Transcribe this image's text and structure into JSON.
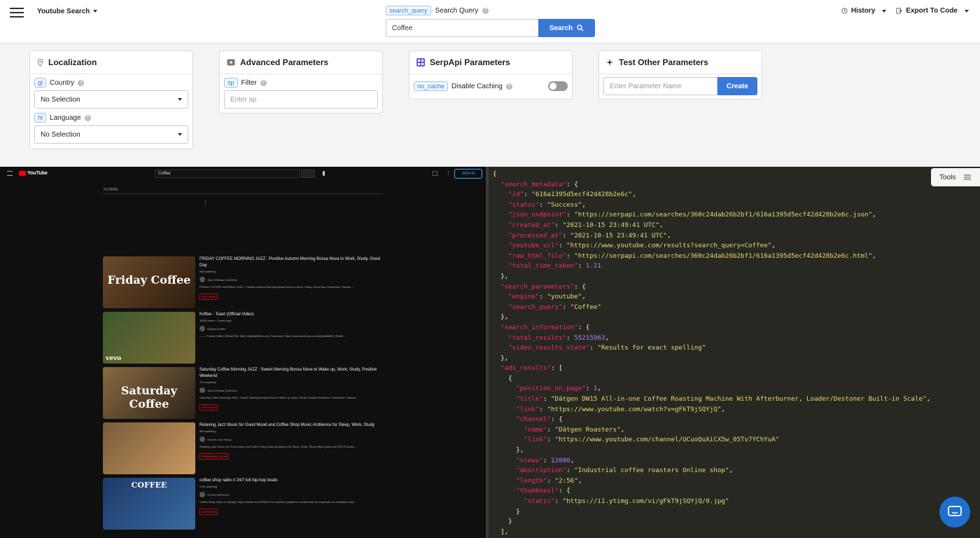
{
  "topbar": {
    "engine_label": "Youtube Search",
    "query_tag": "search_query",
    "query_label": "Search Query",
    "query_value": "Coffee",
    "search_button": "Search",
    "history_label": "History",
    "export_label": "Export To Code"
  },
  "cards": {
    "localization": {
      "title": "Localization",
      "country_tag": "gl",
      "country_label": "Country",
      "country_value": "No Selection",
      "language_tag": "hl",
      "language_label": "Language",
      "language_value": "No Selection"
    },
    "advanced": {
      "title": "Advanced Parameters",
      "filter_tag": "sp",
      "filter_label": "Filter",
      "filter_placeholder": "Enter sp"
    },
    "serpapi": {
      "title": "SerpApi Parameters",
      "cache_tag": "no_cache",
      "cache_label": "Disable Caching"
    },
    "test": {
      "title": "Test Other Parameters",
      "param_placeholder": "Enter Parameter Name",
      "create_button": "Create"
    }
  },
  "youtube": {
    "logo": "YouTube",
    "search_value": "Coffee",
    "signin": "SIGN IN",
    "filters": "FILTERS",
    "videos": [
      {
        "title": "FRIDAY COFFEE MORNING JAZZ : Positive Autumn Morning Bossa Nova to Work, Study, Good Day",
        "meta": "588 watching",
        "channel": "Jazz & Bossa Collection",
        "desc": "FRIDAY COFFEE MORNING JAZZ : Positive Autumn Morning Bossa Nova to Work, Study, Good Day. Download / Stream ...",
        "badge": "LIVE NOW",
        "thumb_text": "Friday Coffee"
      },
      {
        "title": "Koffee - Toast (Official Video)",
        "meta": "184M views • 3 years ago",
        "channel": "Original Koffee",
        "desc": "------- Follow Koffee Official Site: http://originalkoffee.com Facebook: https://www.facebook.com/originalkoffee Twitter: ...",
        "badge": "",
        "thumb_text": "vevo"
      },
      {
        "title": "Saturday Coffee Morning JAZZ : Sweet Morning Bossa Nova to Wake up, Work, Study, Positive Weekend",
        "meta": "974 watching",
        "channel": "Jazz & Bossa Collection",
        "desc": "Saturday Coffee Morning JAZZ : Sweet Morning Bossa Nova to Wake up, Work, Study, Positive Weekend. Download / Stream ...",
        "badge": "LIVE NOW",
        "thumb_text": "Saturday Coffee"
      },
      {
        "title": "Relaxing Jazz Music for Good Mood and Coffee Shop Music Ambience for Sleep, Work, Study",
        "meta": "869 watching",
        "channel": "Smooth Jazz Music",
        "desc": "Relaxing Jazz Music for Good Mood and Coffee Shop Music Ambience for Sleep, Work, Study https://youtu.be/7JRr7KomJIA ...",
        "badge": "PREMIERING NOW",
        "thumb_text": ""
      },
      {
        "title": "coffee shop radio // 24/7 lofi hip-hop beats",
        "meta": "1.3K watching",
        "channel": "STEEZYASFUCK",
        "desc": "Coffee Shop Vibes on Spotify: https://fanlink.to/CSVibes This stream's playlist is curated with an emphasis on meditation and ...",
        "badge": "LIVE NOW",
        "thumb_text": "COFFEE"
      }
    ]
  },
  "tools_label": "Tools",
  "json_lines": [
    [
      [
        "p",
        "{"
      ]
    ],
    [
      [
        "p",
        "  "
      ],
      [
        "k",
        "\"search_metadata\""
      ],
      [
        "p",
        ": {"
      ]
    ],
    [
      [
        "p",
        "    "
      ],
      [
        "k",
        "\"id\""
      ],
      [
        "p",
        ": "
      ],
      [
        "s",
        "\"616a1395d5ecf42d428b2e6c\""
      ],
      [
        "p",
        ","
      ]
    ],
    [
      [
        "p",
        "    "
      ],
      [
        "k",
        "\"status\""
      ],
      [
        "p",
        ": "
      ],
      [
        "s",
        "\"Success\""
      ],
      [
        "p",
        ","
      ]
    ],
    [
      [
        "p",
        "    "
      ],
      [
        "k",
        "\"json_endpoint\""
      ],
      [
        "p",
        ": "
      ],
      [
        "s",
        "\"https://serpapi.com/searches/360c24dab26b2bf1/616a1395d5ecf42d428b2e6c.json\""
      ],
      [
        "p",
        ","
      ]
    ],
    [
      [
        "p",
        "    "
      ],
      [
        "k",
        "\"created_at\""
      ],
      [
        "p",
        ": "
      ],
      [
        "s",
        "\"2021-10-15 23:49:41 UTC\""
      ],
      [
        "p",
        ","
      ]
    ],
    [
      [
        "p",
        "    "
      ],
      [
        "k",
        "\"processed_at\""
      ],
      [
        "p",
        ": "
      ],
      [
        "s",
        "\"2021-10-15 23:49:41 UTC\""
      ],
      [
        "p",
        ","
      ]
    ],
    [
      [
        "p",
        "    "
      ],
      [
        "k",
        "\"youtube_url\""
      ],
      [
        "p",
        ": "
      ],
      [
        "s",
        "\"https://www.youtube.com/results?search_query=Coffee\""
      ],
      [
        "p",
        ","
      ]
    ],
    [
      [
        "p",
        "    "
      ],
      [
        "k",
        "\"raw_html_file\""
      ],
      [
        "p",
        ": "
      ],
      [
        "s",
        "\"https://serpapi.com/searches/360c24dab26b2bf1/616a1395d5ecf42d428b2e6c.html\""
      ],
      [
        "p",
        ","
      ]
    ],
    [
      [
        "p",
        "    "
      ],
      [
        "k",
        "\"total_time_taken\""
      ],
      [
        "p",
        ": "
      ],
      [
        "n",
        "1.21"
      ]
    ],
    [
      [
        "p",
        "  },"
      ]
    ],
    [
      [
        "p",
        "  "
      ],
      [
        "k",
        "\"search_parameters\""
      ],
      [
        "p",
        ": {"
      ]
    ],
    [
      [
        "p",
        "    "
      ],
      [
        "k",
        "\"engine\""
      ],
      [
        "p",
        ": "
      ],
      [
        "s",
        "\"youtube\""
      ],
      [
        "p",
        ","
      ]
    ],
    [
      [
        "p",
        "    "
      ],
      [
        "k",
        "\"search_query\""
      ],
      [
        "p",
        ": "
      ],
      [
        "s",
        "\"Coffee\""
      ]
    ],
    [
      [
        "p",
        "  },"
      ]
    ],
    [
      [
        "p",
        "  "
      ],
      [
        "k",
        "\"search_information\""
      ],
      [
        "p",
        ": {"
      ]
    ],
    [
      [
        "p",
        "    "
      ],
      [
        "k",
        "\"total_results\""
      ],
      [
        "p",
        ": "
      ],
      [
        "n",
        "55215963"
      ],
      [
        "p",
        ","
      ]
    ],
    [
      [
        "p",
        "    "
      ],
      [
        "k",
        "\"video_results_state\""
      ],
      [
        "p",
        ": "
      ],
      [
        "s",
        "\"Results for exact spelling\""
      ]
    ],
    [
      [
        "p",
        "  },"
      ]
    ],
    [
      [
        "p",
        "  "
      ],
      [
        "k",
        "\"ads_results\""
      ],
      [
        "p",
        ": ["
      ]
    ],
    [
      [
        "p",
        "    {"
      ]
    ],
    [
      [
        "p",
        "      "
      ],
      [
        "k",
        "\"position_on_page\""
      ],
      [
        "p",
        ": "
      ],
      [
        "n",
        "1"
      ],
      [
        "p",
        ","
      ]
    ],
    [
      [
        "p",
        "      "
      ],
      [
        "k",
        "\"title\""
      ],
      [
        "p",
        ": "
      ],
      [
        "s",
        "\"Dätgen DW15 All-in-one Coffee Roasting Machine With Afterburner, Loader/Destoner Built-in Scale\""
      ],
      [
        "p",
        ","
      ]
    ],
    [
      [
        "p",
        "      "
      ],
      [
        "k",
        "\"link\""
      ],
      [
        "p",
        ": "
      ],
      [
        "s",
        "\"https://www.youtube.com/watch?v=gFkT9jSQYjQ\""
      ],
      [
        "p",
        ","
      ]
    ],
    [
      [
        "p",
        "      "
      ],
      [
        "k",
        "\"channel\""
      ],
      [
        "p",
        ": {"
      ]
    ],
    [
      [
        "p",
        "        "
      ],
      [
        "k",
        "\"name\""
      ],
      [
        "p",
        ": "
      ],
      [
        "s",
        "\"Dätgen Roasters\""
      ],
      [
        "p",
        ","
      ]
    ],
    [
      [
        "p",
        "        "
      ],
      [
        "k",
        "\"link\""
      ],
      [
        "p",
        ": "
      ],
      [
        "s",
        "\"https://www.youtube.com/channel/UCuoQuXiCX5w_05Tv7YChYuA\""
      ]
    ],
    [
      [
        "p",
        "      },"
      ]
    ],
    [
      [
        "p",
        "      "
      ],
      [
        "k",
        "\"views\""
      ],
      [
        "p",
        ": "
      ],
      [
        "n",
        "12000"
      ],
      [
        "p",
        ","
      ]
    ],
    [
      [
        "p",
        "      "
      ],
      [
        "k",
        "\"description\""
      ],
      [
        "p",
        ": "
      ],
      [
        "s",
        "\"Industrial coffee roasters Online shop\""
      ],
      [
        "p",
        ","
      ]
    ],
    [
      [
        "p",
        "      "
      ],
      [
        "k",
        "\"length\""
      ],
      [
        "p",
        ": "
      ],
      [
        "s",
        "\"2:56\""
      ],
      [
        "p",
        ","
      ]
    ],
    [
      [
        "p",
        "      "
      ],
      [
        "k",
        "\"thumbnail\""
      ],
      [
        "p",
        ": {"
      ]
    ],
    [
      [
        "p",
        "        "
      ],
      [
        "k",
        "\"static\""
      ],
      [
        "p",
        ": "
      ],
      [
        "s",
        "\"https://i1.ytimg.com/vi/gFkT9jSQYjQ/0.jpg\""
      ]
    ],
    [
      [
        "p",
        "      }"
      ]
    ],
    [
      [
        "p",
        "    }"
      ]
    ],
    [
      [
        "p",
        "  ],"
      ]
    ]
  ]
}
